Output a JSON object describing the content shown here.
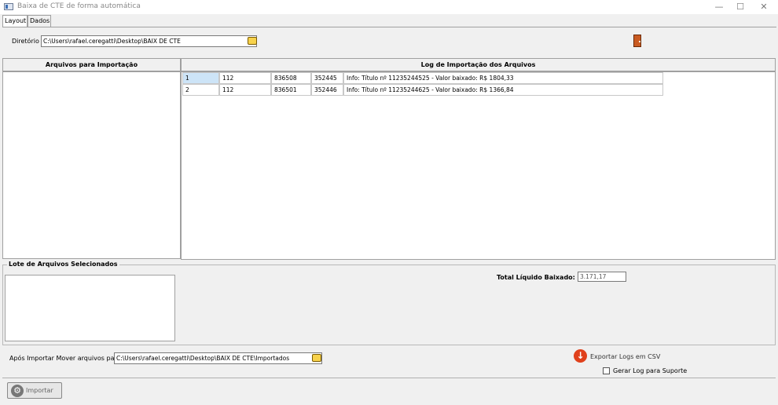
{
  "window": {
    "title": "Baixa de CTE de forma automática",
    "minimize_icon": "—",
    "maximize_icon": "☐",
    "close_icon": "✕"
  },
  "tabs": [
    {
      "label": "Layout",
      "active": true
    },
    {
      "label": "Dados",
      "active": false
    }
  ],
  "directory": {
    "label": "Diretório",
    "value": "C:\\Users\\rafael.ceregatti\\Desktop\\BAIX DE CTE"
  },
  "left_panel": {
    "title": "Arquivos para Importação"
  },
  "log_panel": {
    "title": "Log de Importação dos Arquivos",
    "rows": [
      [
        "1",
        "112",
        "836508",
        "352445",
        "Info: Título nº 11235244525 - Valor baixado: R$ 1804,33"
      ],
      [
        "2",
        "112",
        "836501",
        "352446",
        "Info: Título nº 11235244625 - Valor baixado: R$ 1366,84"
      ]
    ]
  },
  "batch": {
    "title": "Lote de Arquivos Selecionados"
  },
  "total": {
    "label": "Total Líquido Baixado: R$",
    "value": "3.171,17"
  },
  "move": {
    "label": "Após Importar Mover arquivos para :",
    "value": "C:\\Users\\rafael.ceregatti\\Desktop\\BAIX DE CTE\\Importados"
  },
  "export": {
    "label": "Exportar Logs em CSV",
    "icon": "arrow-down-circle-icon"
  },
  "support": {
    "label": "Gerar Log para Suporte",
    "checked": false
  },
  "import_button": {
    "label": "Importar"
  },
  "colors": {
    "selection": "#cde4f7",
    "export_icon": "#e0401b",
    "folder_icon": "#f7d24b",
    "exit_icon": "#c95a21"
  }
}
